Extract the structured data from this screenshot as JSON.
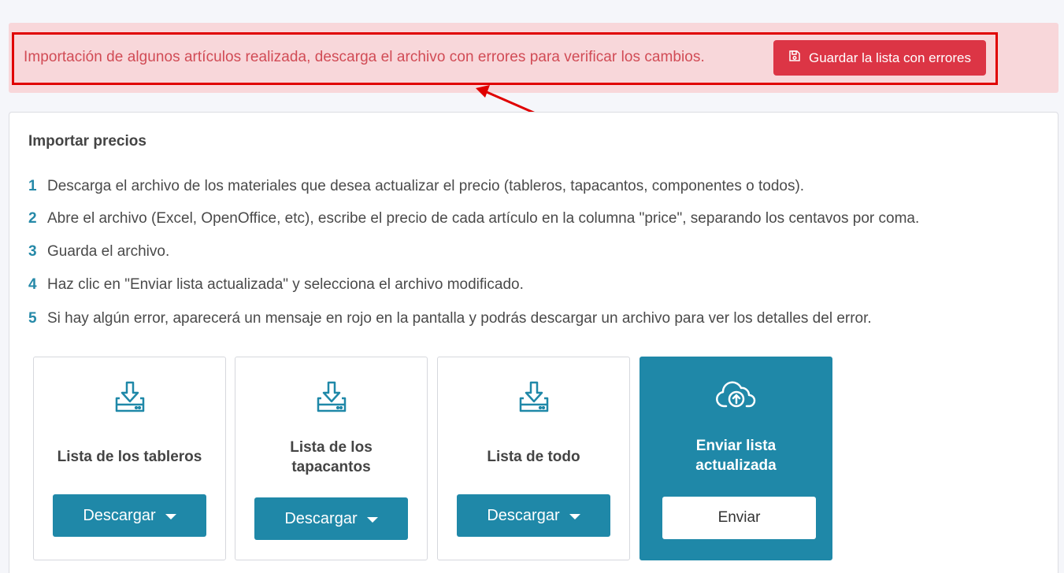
{
  "alert": {
    "message": "Importación de algunos artículos realizada, descarga el archivo con errores para verificar los cambios.",
    "button_label": "Guardar la lista con errores",
    "button_icon": "save-icon",
    "color": "#dc3545"
  },
  "section": {
    "title": "Importar precios",
    "steps": [
      {
        "num": "1",
        "text": "Descarga el archivo de los materiales que desea actualizar el precio (tableros, tapacantos, componentes o todos)."
      },
      {
        "num": "2",
        "text": "Abre el archivo (Excel, OpenOffice, etc), escribe el precio de cada artículo en la columna \"price\", separando los centavos por coma."
      },
      {
        "num": "3",
        "text": "Guarda el archivo."
      },
      {
        "num": "4",
        "text": "Haz clic en \"Enviar lista actualizada\" y selecciona el archivo modificado."
      },
      {
        "num": "5",
        "text": "Si hay algún error, aparecerá un mensaje en rojo en la pantalla y podrás descargar un archivo para ver los detalles del error."
      }
    ]
  },
  "tiles": [
    {
      "label": "Lista de los tableros",
      "button": "Descargar",
      "icon": "download-tray-icon"
    },
    {
      "label": "Lista de los tapacantos",
      "button": "Descargar",
      "icon": "download-tray-icon"
    },
    {
      "label": "Lista de todo",
      "button": "Descargar",
      "icon": "download-tray-icon"
    }
  ],
  "upload": {
    "label": "Enviar lista actualizada",
    "button": "Enviar",
    "icon": "cloud-upload-icon"
  },
  "colors": {
    "accent": "#1f88a8",
    "alert_bg": "#f8d7da",
    "alert_text": "#d14b55",
    "highlight": "#e00000"
  }
}
